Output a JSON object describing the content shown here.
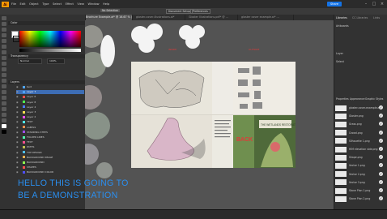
{
  "menu": {
    "app_logo": "Ai",
    "items": [
      "File",
      "Edit",
      "Object",
      "Type",
      "Select",
      "Effect",
      "View",
      "Window",
      "Help"
    ],
    "share_label": "Share"
  },
  "control_bar": {
    "selection_label": "No Selection",
    "document_setup": "Document Setup",
    "preferences": "Preferences"
  },
  "tabs": [
    {
      "label": "Glossier Brochure Template.ai* @ 75.87% (CMYK/...",
      "active": false
    },
    {
      "label": "Gloster Brochure Example.ai* @ 16.67 % (CMYK/Preview)",
      "active": true
    },
    {
      "label": "gloster-cover-illustrations.ai*",
      "active": false
    },
    {
      "label": "Gloster Illustrations.pdf* @ ...",
      "active": false
    },
    {
      "label": "gloster cover example.ai* ...",
      "active": false
    }
  ],
  "left_panel": {
    "color_title": "Color",
    "properties_title": "Transparency",
    "blend_mode": "Normal",
    "opacity": "100%",
    "layers_title": "Layers",
    "layers": [
      {
        "name": "text",
        "color": "#4fa3ff",
        "selected": false
      },
      {
        "name": "Layer 7",
        "color": "#4fa3ff",
        "selected": true
      },
      {
        "name": "Layer 6",
        "color": "#ff4f4f",
        "selected": false
      },
      {
        "name": "Layer 8",
        "color": "#4fff4f",
        "selected": false
      },
      {
        "name": "Layer 4",
        "color": "#4f7cff",
        "selected": false
      },
      {
        "name": "Layer 3",
        "color": "#ffdf4f",
        "selected": false
      },
      {
        "name": "Layer 2",
        "color": "#ff4fff",
        "selected": false
      },
      {
        "name": "TEXT",
        "color": "#4fffff",
        "selected": false
      },
      {
        "name": "LABELS",
        "color": "#ff8f4f",
        "selected": false
      },
      {
        "name": "STANDING STEPS",
        "color": "#9f4fff",
        "selected": false
      },
      {
        "name": "FOLDER LINES",
        "color": "#4fffaf",
        "selected": false
      },
      {
        "name": "TEXT",
        "color": "#ff4f8f",
        "selected": false
      },
      {
        "name": "PATHS",
        "color": "#bfbf4f",
        "selected": false
      },
      {
        "name": "TOP DESIGN",
        "color": "#4fbfff",
        "selected": false
      },
      {
        "name": "BACKGROUND IMAGE",
        "color": "#ffaf4f",
        "selected": false
      },
      {
        "name": "BACKGROUND",
        "color": "#8fff4f",
        "selected": false
      },
      {
        "name": "SHAPES",
        "color": "#ff4f4f",
        "selected": false
      },
      {
        "name": "BACKGROUND COLOR",
        "color": "#4f4fff",
        "selected": false
      }
    ]
  },
  "artboard": {
    "back_label": "BACK",
    "book_title": "THE WETLANDS RESTORATION",
    "ab_labels": [
      "INSIDE",
      "OUTSIDE"
    ]
  },
  "right_panel": {
    "tabs": [
      "Libraries",
      "CC Libraries",
      "Links"
    ],
    "section": "Artboards",
    "layer_label": "Layer",
    "select_label": "Select",
    "row_labels": [
      "Properties",
      "Appearance",
      "Graphic Styles"
    ],
    "links_title": "Links",
    "links": [
      "gloster-cover-example.ai",
      "Gloster.png",
      "Grass.png",
      "Crowd.png",
      "Silhouette 1.png",
      "HIM elevation side.png",
      "Shape.png",
      "Vector 1.png",
      "Vector 2.png",
      "Vector 3.png",
      "Stone Plan 1.png",
      "Stone Plan 2.png"
    ]
  },
  "overlay": {
    "line1": "HELLO THIS IS GOING TO",
    "line2": "BE A DEMONSTRATION"
  },
  "colors": {
    "overlay_text": "#2a8ff0",
    "accent_orange": "#ff9a00",
    "share_blue": "#1473e6",
    "artboard_label_red": "#e03a3a"
  }
}
